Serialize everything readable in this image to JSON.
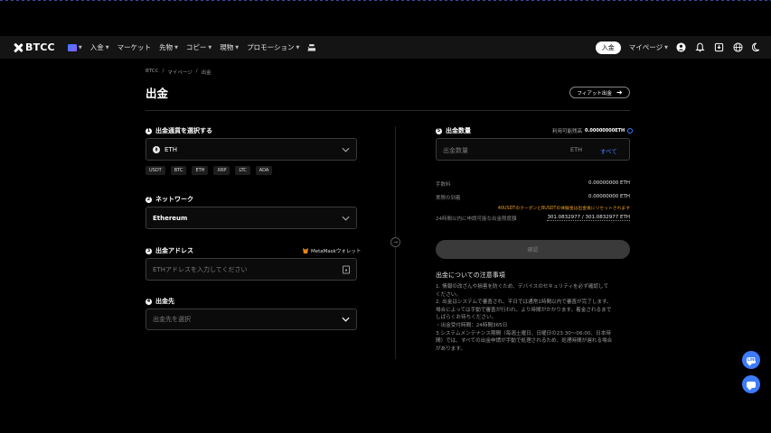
{
  "brand": "BTCC",
  "nav": {
    "items": [
      {
        "label": "入金",
        "caret": true
      },
      {
        "label": "マーケット",
        "caret": false
      },
      {
        "label": "先物",
        "caret": true
      },
      {
        "label": "コピー",
        "caret": true
      },
      {
        "label": "現物",
        "caret": true
      },
      {
        "label": "プロモーション",
        "caret": true
      }
    ],
    "deposit_label": "入金",
    "mypage_label": "マイページ"
  },
  "breadcrumb": [
    "BTCC",
    "/",
    "マイページ",
    "/",
    "出金"
  ],
  "page_title": "出金",
  "fiat_button": "フィアット出金",
  "steps": {
    "coin": {
      "num": "1",
      "label": "出金通貨を選択する",
      "selected": "ETH"
    },
    "network": {
      "num": "2",
      "label": "ネットワーク",
      "selected": "Ethereum"
    },
    "address": {
      "num": "3",
      "label": "出金アドレス",
      "placeholder": "ETHアドレスを入力してください",
      "metamask": "MetaMaskウォレット"
    },
    "destination": {
      "num": "4",
      "label": "出金先",
      "placeholder": "出金先を選択"
    },
    "amount": {
      "num": "5",
      "label": "出金数量",
      "placeholder": "出金数量",
      "unit": "ETH",
      "all": "すべて"
    }
  },
  "quick_coins": [
    "USDT",
    "BTC",
    "ETH",
    "XRP",
    "LTC",
    "ADA"
  ],
  "available": {
    "label": "利用可能残高",
    "value": "0.00000000ETH"
  },
  "fee": {
    "label": "手数料",
    "value": "0.00000000 ETH"
  },
  "received": {
    "label": "実際の到着",
    "value": "0.00000000 ETH"
  },
  "warning": "40USDTのクーポンとBUSDTの体験金は出金後にリセットされます",
  "limit": {
    "label": "24時間以内に申請可能な出金限度額",
    "value": "301.0832977 / 301.0832977 ETH"
  },
  "confirm_label": "確認",
  "notes_title": "出金についての注意事項",
  "notes": [
    "1. 情報の改ざんや損害を防ぐため、デバイスのセキュリティを必ず確認して",
    "ください。",
    "2. 出金はシステムで審査され、平日では通常1時間以内で審査が完了します。",
    "場合によっては手動で審査が行われ、より時間がかかります。着金されるまで",
    "しばらくお待ちください。",
    "・出金受付時間：24時間365日",
    "3.システムメンテナンス期間（毎週土曜日、日曜日の23:30～06:00、日本時",
    "間）では、すべての出金申請が手動で処理されるため、処理時間が遅れる場合",
    "があります。"
  ],
  "float": {
    "line_label": "LINE"
  }
}
